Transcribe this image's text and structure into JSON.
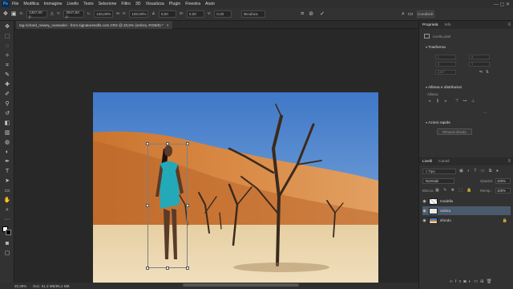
{
  "app": {
    "logo": "Ps"
  },
  "menu": [
    "File",
    "Modifica",
    "Immagine",
    "Livello",
    "Testo",
    "Selezione",
    "Filtro",
    "3D",
    "Visualizza",
    "Plugin",
    "Finestra",
    "Aiuto"
  ],
  "options": {
    "x_label": "X:",
    "x_value": "1357,00 p",
    "y_label": "Y:",
    "y_value": "3047,50 p",
    "w_label": "L:",
    "w_value": "100,00%",
    "h_label": "A:",
    "h_value": "100,00%",
    "angle_value": "0,00",
    "hskew_label": "O:",
    "hskew_value": "0,00",
    "vskew_label": "V:",
    "vskew_value": "0,00",
    "interp_value": "Bicubica",
    "share_label": "Condividi"
  },
  "document": {
    "tab_title": "tag-richard_newey_ooesavlei - from signaturesolls.com.CR2 @ 20,6% (ombra, RGB/8) *",
    "close_glyph": "×"
  },
  "status": {
    "zoom": "20,39%",
    "doc_info": "Doc: 51,3 MB/86,4 MB"
  },
  "properties_panel": {
    "tabs": [
      "Proprietà",
      "Info"
    ],
    "kind_label": "Livello pixel",
    "transform_title": "Trasforma",
    "transform_fields": [
      "L",
      "A",
      "X",
      "Y",
      "0,00°"
    ],
    "align_title": "Allinea e distribuisci",
    "align_sub": "Allinea:",
    "more_glyph": "···",
    "quick_title": "Azioni rapide",
    "quick_btn": "Rimuovi sfondo"
  },
  "layers_panel": {
    "tabs": [
      "Livelli",
      "Canali"
    ],
    "filter_label": "Tipo",
    "blend_mode": "Normale",
    "opacity_label": "Opacità:",
    "opacity_value": "100%",
    "lock_label": "Blocca:",
    "fill_label": "Riemp.:",
    "fill_value": "100%",
    "layers": [
      {
        "name": "modella",
        "selected": false
      },
      {
        "name": "ombra",
        "selected": true
      },
      {
        "name": "sfondo",
        "selected": false
      }
    ]
  },
  "colors": {
    "accent": "#31a8ff",
    "selected_layer": "#4b5a6b",
    "workspace": "#282828",
    "panel": "#323232"
  }
}
